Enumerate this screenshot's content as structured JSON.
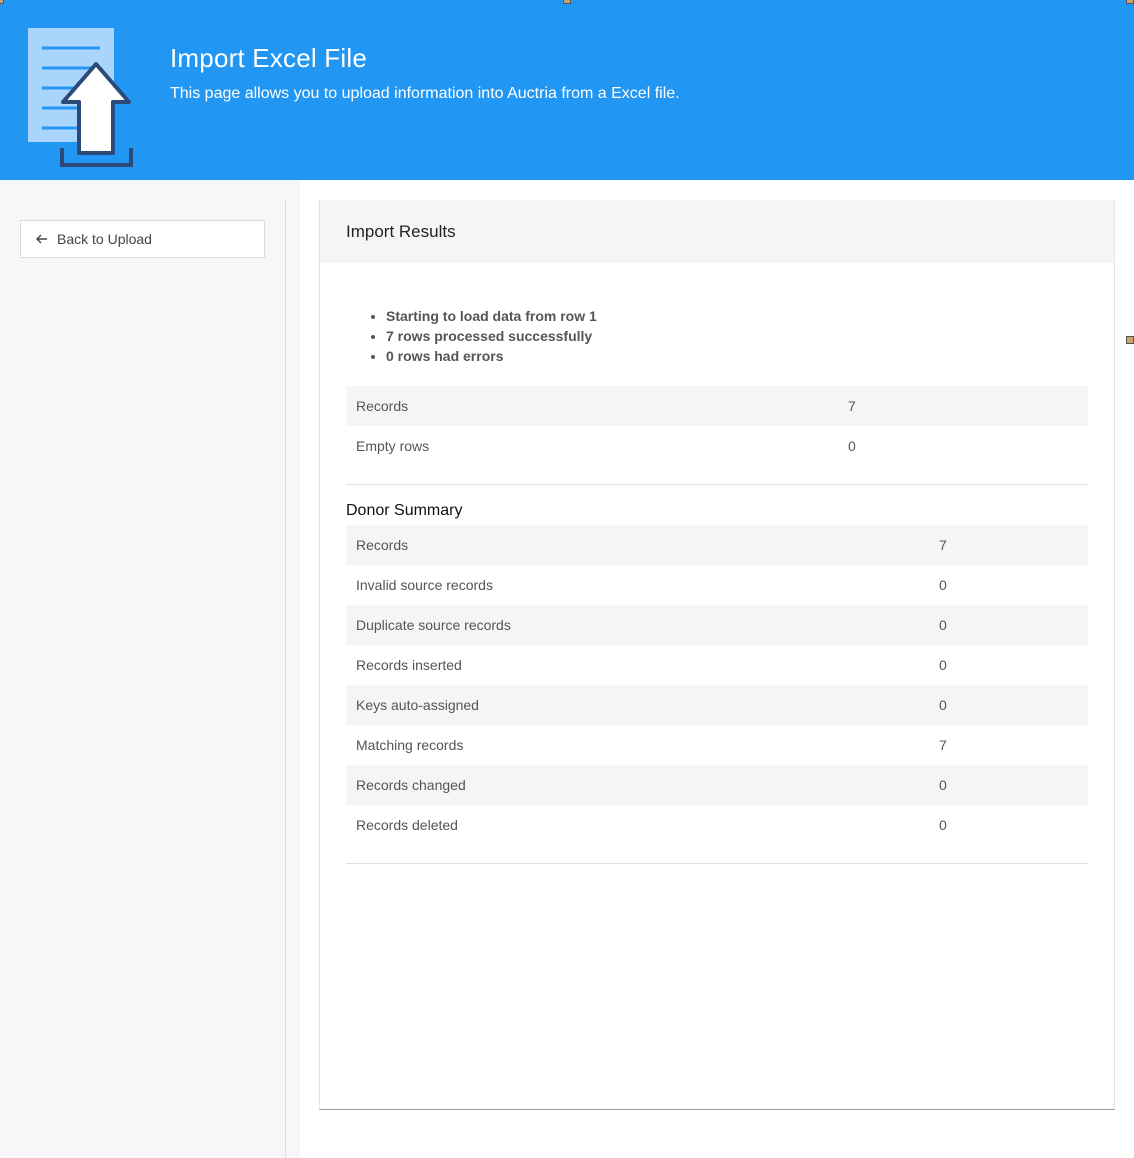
{
  "header": {
    "title": "Import Excel File",
    "subtitle": "This page allows you to upload information into Auctria from a Excel file.",
    "icon": "upload-file-icon",
    "color": "#2196F3"
  },
  "sidebar": {
    "back_button_label": "Back to Upload",
    "back_icon": "arrow-left-icon"
  },
  "results": {
    "title": "Import Results",
    "messages": [
      "Starting to load data from row 1",
      "7 rows processed successfully",
      "0 rows had errors"
    ],
    "summary_rows": [
      {
        "label": "Records",
        "value": "7"
      },
      {
        "label": "Empty rows",
        "value": "0"
      }
    ]
  },
  "donor_summary": {
    "title": "Donor Summary",
    "rows": [
      {
        "label": "Records",
        "value": "7"
      },
      {
        "label": "Invalid source records",
        "value": "0"
      },
      {
        "label": "Duplicate source records",
        "value": "0"
      },
      {
        "label": "Records inserted",
        "value": "0"
      },
      {
        "label": "Keys auto-assigned",
        "value": "0"
      },
      {
        "label": "Matching records",
        "value": "7"
      },
      {
        "label": "Records changed",
        "value": "0"
      },
      {
        "label": "Records deleted",
        "value": "0"
      }
    ]
  }
}
